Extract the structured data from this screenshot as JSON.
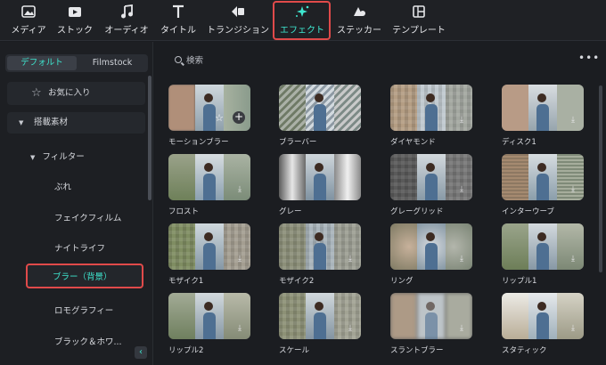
{
  "toolbar": {
    "tools": [
      {
        "label": "メディア",
        "icon": "media-icon"
      },
      {
        "label": "ストック",
        "icon": "stock-icon"
      },
      {
        "label": "オーディオ",
        "icon": "audio-icon"
      },
      {
        "label": "タイトル",
        "icon": "title-icon"
      },
      {
        "label": "トランジション",
        "icon": "transition-icon"
      },
      {
        "label": "エフェクト",
        "icon": "effect-icon",
        "active": true
      },
      {
        "label": "ステッカー",
        "icon": "sticker-icon"
      },
      {
        "label": "テンプレート",
        "icon": "template-icon"
      }
    ]
  },
  "sidebar": {
    "tabs": [
      {
        "label": "デフォルト",
        "active": true
      },
      {
        "label": "Filmstock"
      }
    ],
    "favorites": "お気に入り",
    "category": "搭載素材",
    "filter_group": "フィルター",
    "items": [
      "ぶれ",
      "フェイクフィルム",
      "ナイトライフ",
      "ブラー（背景）",
      "ロモグラフィー",
      "ブラック＆ホワ..."
    ],
    "selected_item": "ブラー（背景）",
    "collapse_glyph": "‹"
  },
  "main": {
    "search_placeholder": "検索",
    "more_glyph": "•••",
    "effects": [
      {
        "name": "モーションブラー"
      },
      {
        "name": "ブラーバー"
      },
      {
        "name": "ダイヤモンド"
      },
      {
        "name": "ディスク1"
      },
      {
        "name": "フロスト"
      },
      {
        "name": "グレー"
      },
      {
        "name": "グレーグリッド"
      },
      {
        "name": "インターウーブ"
      },
      {
        "name": "モザイク1"
      },
      {
        "name": "モザイク2"
      },
      {
        "name": "リング"
      },
      {
        "name": "リップル1"
      },
      {
        "name": "リップル2"
      },
      {
        "name": "スケール"
      },
      {
        "name": "スラントブラー"
      },
      {
        "name": "スタティック"
      }
    ]
  },
  "colors": {
    "accent": "#3ee6cf",
    "highlight": "#e04a4a"
  }
}
